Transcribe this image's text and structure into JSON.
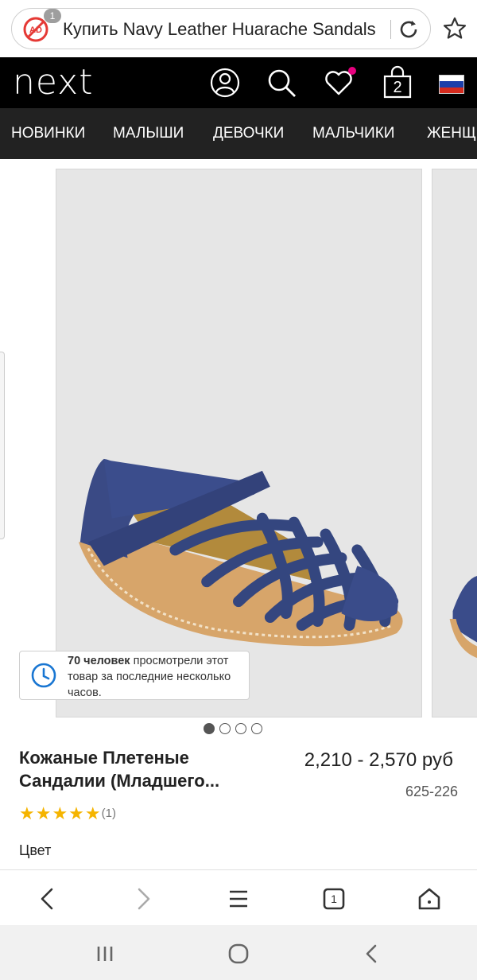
{
  "browser": {
    "url_text": "Купить Navy Leather Huarache Sandals",
    "adblock_count": "1",
    "icons": [
      "adblock-icon",
      "reload-icon",
      "star-icon"
    ]
  },
  "header": {
    "logo": "next",
    "cart_count": "2",
    "wishlist_dot_color": "#e6007e"
  },
  "nav": {
    "items": [
      "НОВИНКИ",
      "МАЛЫШИ",
      "ДЕВОЧКИ",
      "МАЛЬЧИКИ",
      "ЖЕНЩ"
    ]
  },
  "gallery": {
    "views_bold": "70 человек",
    "views_rest": " просмотрели этот товар за последние несколько часов.",
    "dots_total": 4,
    "dots_active": 1
  },
  "product": {
    "title": "Кожаные Плетеные Сандалии (Младшего...",
    "price": "2,210 - 2,570 руб",
    "sku": "625-226",
    "stars": "★★★★★",
    "rating_count": "(1)",
    "color_label": "Цвет"
  },
  "colors": {
    "header_bg": "#000000",
    "nav_bg": "#222222",
    "star_color": "#f5b400"
  }
}
